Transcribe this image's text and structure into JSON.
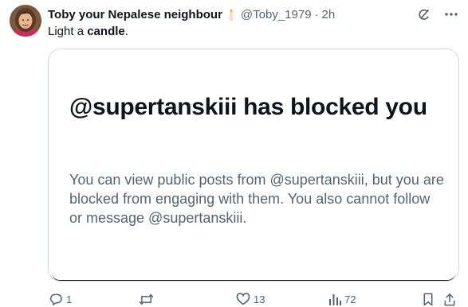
{
  "author": {
    "display_name": "Toby your Nepalese neighbour",
    "handle": "@Toby_1979",
    "separator": "·",
    "time": "2h",
    "name_emoji": "candle-emoji"
  },
  "tweet": {
    "text_prefix": "Light a ",
    "text_bold": "candle",
    "text_suffix": "."
  },
  "card": {
    "title": "@supertanskiii has blocked you",
    "body": "You can view public posts from @supertanskiii, but you are blocked from engaging with them. You also cannot follow or message @supertanskiii."
  },
  "actions": {
    "replies": "1",
    "reposts": "",
    "likes": "13",
    "views": "72"
  },
  "icons": {
    "header": [
      "grok-icon",
      "more-icon"
    ],
    "actions": [
      "reply-icon",
      "repost-icon",
      "like-icon",
      "views-icon",
      "bookmark-icon",
      "share-icon"
    ]
  },
  "colors": {
    "text_primary": "#0f1419",
    "text_secondary": "#536471",
    "border": "#cfd9de"
  }
}
